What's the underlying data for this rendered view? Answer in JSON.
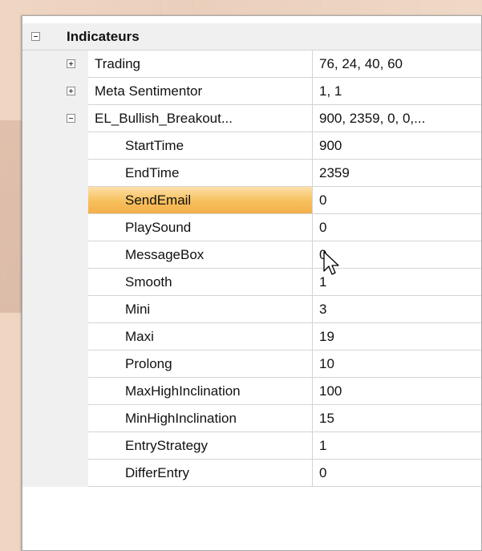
{
  "category": {
    "label": "Indicateurs",
    "expanded": true
  },
  "rows": [
    {
      "name": "Trading",
      "value": "76, 24, 40, 60",
      "toggle": "plus"
    },
    {
      "name": "Meta Sentimentor",
      "value": "1, 1",
      "toggle": "plus"
    },
    {
      "name": "EL_Bullish_Breakout...",
      "value": "900, 2359, 0, 0,...",
      "toggle": "minus"
    }
  ],
  "properties": [
    {
      "name": "StartTime",
      "value": "900"
    },
    {
      "name": "EndTime",
      "value": "2359"
    },
    {
      "name": "SendEmail",
      "value": "0",
      "selected": true
    },
    {
      "name": "PlaySound",
      "value": "0"
    },
    {
      "name": "MessageBox",
      "value": "0"
    },
    {
      "name": "Smooth",
      "value": "1"
    },
    {
      "name": "Mini",
      "value": "3"
    },
    {
      "name": "Maxi",
      "value": "19"
    },
    {
      "name": "Prolong",
      "value": "10"
    },
    {
      "name": "MaxHighInclination",
      "value": "100"
    },
    {
      "name": "MinHighInclination",
      "value": "15"
    },
    {
      "name": "EntryStrategy",
      "value": "1"
    },
    {
      "name": "DifferEntry",
      "value": "0"
    }
  ],
  "colors": {
    "selection": "#f7bf5c",
    "margin": "#f0f0f0",
    "grid": "#d4d4d4"
  },
  "icons": {
    "expand": "plus-box-icon",
    "collapse": "minus-box-icon",
    "cursor": "mouse-pointer-icon"
  }
}
